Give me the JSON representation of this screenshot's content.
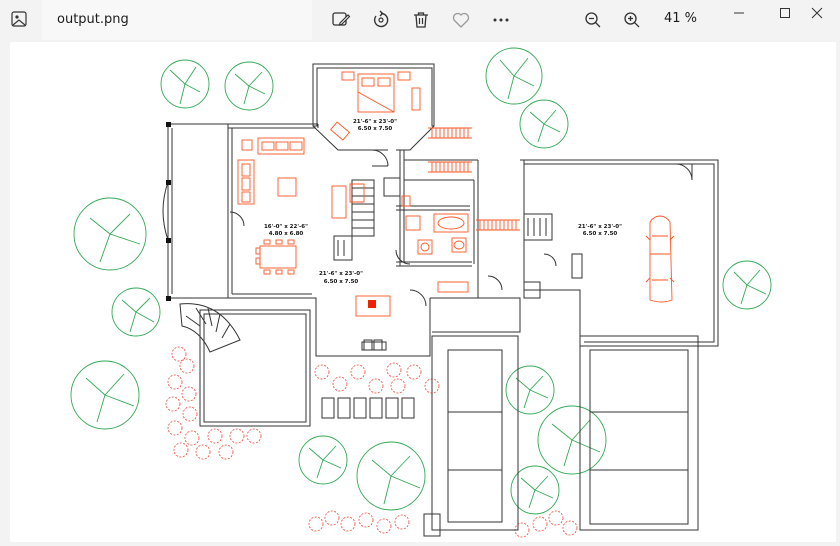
{
  "window": {
    "file_name": "output.png",
    "zoom_percent": "41 %"
  },
  "toolbar": {
    "items": [
      "edit-icon",
      "rotate-icon",
      "delete-icon",
      "favorite-icon",
      "more-icon",
      "zoom-out-icon",
      "zoom-in-icon"
    ]
  },
  "window_controls": [
    "minimize-icon",
    "maximize-icon",
    "close-icon"
  ],
  "floorplan": {
    "room_master_bed": {
      "dims_ft": "21'-6\" x 23'-0\"",
      "dims_m": "6.50 x 7.50"
    },
    "room_living": {
      "dims_ft": "16'-0\" x 22'-6\"",
      "dims_m": "4.80 x 6.80"
    },
    "room_family": {
      "dims_ft": "21'-6\" x 23'-0\"",
      "dims_m": "6.50 x 7.50"
    },
    "room_garage": {
      "dims_ft": "21'-6\" x 23'-0\"",
      "dims_m": "6.50 x 7.50"
    },
    "colors": {
      "walls": "#333333",
      "furniture": "#ff5522",
      "trees": "#33aa55",
      "shrubs": "#ee4433"
    }
  }
}
